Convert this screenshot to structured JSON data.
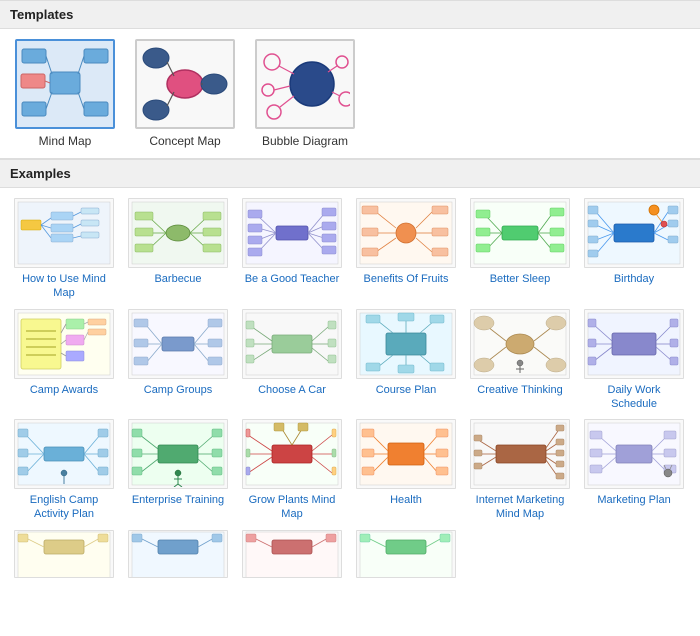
{
  "sections": {
    "templates_header": "Templates",
    "examples_header": "Examples"
  },
  "templates": [
    {
      "id": "mind-map",
      "label": "Mind Map",
      "selected": true
    },
    {
      "id": "concept-map",
      "label": "Concept Map",
      "selected": false
    },
    {
      "id": "bubble-diagram",
      "label": "Bubble Diagram",
      "selected": false
    }
  ],
  "examples": [
    {
      "id": "how-to-use",
      "label": "How to Use Mind Map"
    },
    {
      "id": "barbecue",
      "label": "Barbecue"
    },
    {
      "id": "be-a-good-teacher",
      "label": "Be a Good Teacher"
    },
    {
      "id": "benefits-of-fruits",
      "label": "Benefits Of Fruits"
    },
    {
      "id": "better-sleep",
      "label": "Better Sleep"
    },
    {
      "id": "birthday",
      "label": "Birthday"
    },
    {
      "id": "camp-awards",
      "label": "Camp Awards"
    },
    {
      "id": "camp-groups",
      "label": "Camp Groups"
    },
    {
      "id": "choose-a-car",
      "label": "Choose A Car"
    },
    {
      "id": "course-plan",
      "label": "Course Plan"
    },
    {
      "id": "creative-thinking",
      "label": "Creative Thinking"
    },
    {
      "id": "daily-work-schedule",
      "label": "Daily Work Schedule"
    },
    {
      "id": "english-camp",
      "label": "English Camp Activity Plan"
    },
    {
      "id": "enterprise-training",
      "label": "Enterprise Training"
    },
    {
      "id": "grow-plants",
      "label": "Grow Plants Mind Map"
    },
    {
      "id": "health",
      "label": "Health"
    },
    {
      "id": "internet-marketing",
      "label": "Internet Marketing Mind Map"
    },
    {
      "id": "marketing-plan",
      "label": "Marketing Plan"
    },
    {
      "id": "partial1",
      "label": ""
    },
    {
      "id": "partial2",
      "label": ""
    },
    {
      "id": "partial3",
      "label": ""
    },
    {
      "id": "partial4",
      "label": ""
    }
  ]
}
